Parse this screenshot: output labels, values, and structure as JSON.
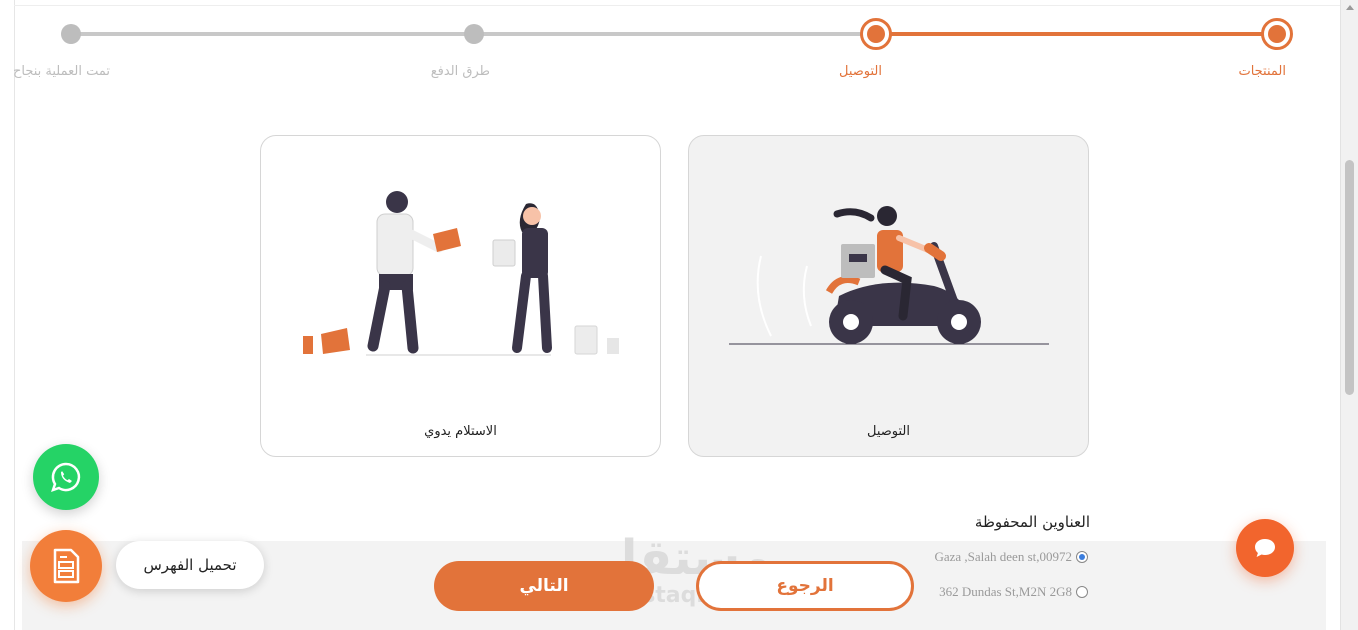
{
  "stepper": {
    "steps": [
      {
        "label": "المنتجات",
        "state": "active"
      },
      {
        "label": "التوصيل",
        "state": "active"
      },
      {
        "label": "طرق الدفع",
        "state": "pending"
      },
      {
        "label": "تمت العملية بنجاح",
        "state": "pending"
      }
    ]
  },
  "delivery_options": {
    "delivery_label": "التوصيل",
    "pickup_label": "الاستلام يدوي",
    "selected": "delivery"
  },
  "addresses": {
    "title": "العناوين المحفوظة",
    "items": [
      {
        "text": "Gaza ,Salah deen st,00972",
        "checked": true
      },
      {
        "text": "362 Dundas St,M2N 2G8",
        "checked": false
      }
    ]
  },
  "actions": {
    "next_label": "التالي",
    "back_label": "الرجوع"
  },
  "floating": {
    "catalog_label": "تحميل الفهرس",
    "whatsapp_icon": "whatsapp-icon",
    "catalog_icon": "document-icon",
    "chat_icon": "chat-bubble-icon"
  },
  "watermark": {
    "arabic": "مستقل",
    "latin": "mostaql.com"
  },
  "colors": {
    "accent": "#e2733a",
    "inactive": "#bdbdbd",
    "whatsapp": "#25d366",
    "chat": "#f2652d"
  }
}
